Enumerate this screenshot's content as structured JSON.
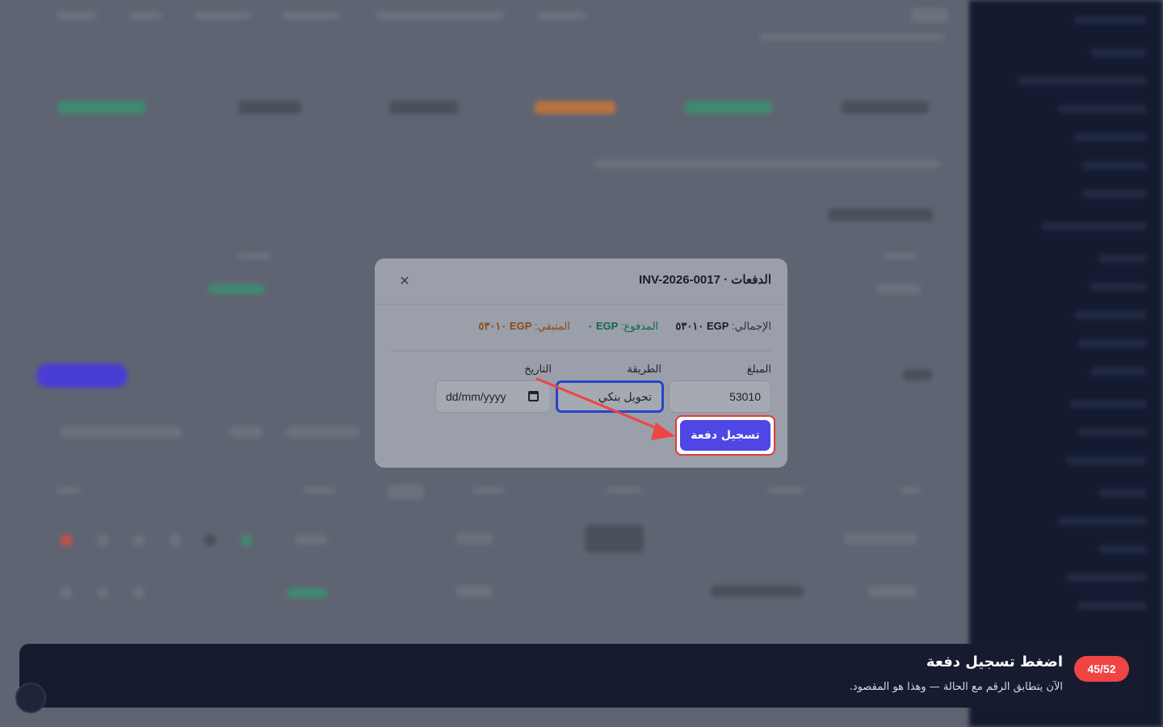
{
  "modal": {
    "title": "الدفعات · INV-2026-0017",
    "close_icon": "close-icon",
    "totals": {
      "total_label": "الإجمالي:",
      "total_value": "EGP ٥٣٠١٠",
      "paid_label": "المدفوع:",
      "paid_value": "EGP ٠",
      "remaining_label": "المتبقي:",
      "remaining_value": "EGP ٥٣٠١٠"
    },
    "fields": {
      "amount_label": "المبلغ",
      "amount_value": "53010",
      "method_label": "الطريقة",
      "method_value": "تحويل بنكي",
      "date_label": "التاريخ",
      "date_placeholder": "dd/mm/yyyy"
    },
    "submit_label": "تسجيل دفعة"
  },
  "tour": {
    "step": "45/52",
    "title": "اضغط تسجيل دفعة",
    "body": "الآن يتطابق الرقم مع الحالة — وهذا هو المقصود."
  },
  "colors": {
    "primary": "#4f46e5",
    "highlight": "#e23b3b",
    "paid": "#0e6b4e",
    "remaining": "#8a4a1a",
    "tour_bg": "#161b30"
  }
}
